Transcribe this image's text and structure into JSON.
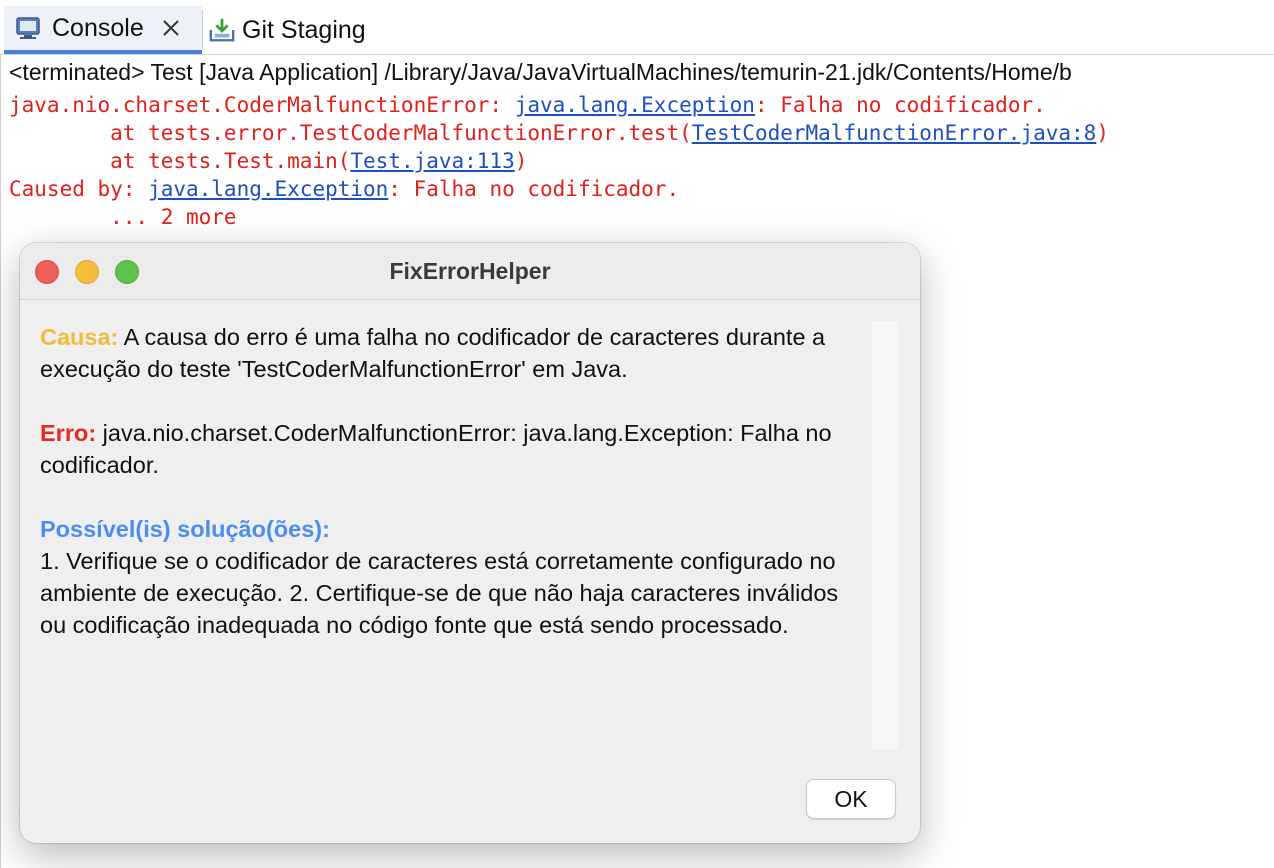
{
  "tabs": [
    {
      "label": "Console",
      "icon": "console-icon",
      "active": true
    },
    {
      "label": "Git Staging",
      "icon": "git-staging-icon",
      "active": false
    }
  ],
  "console": {
    "status": "<terminated> Test [Java Application] /Library/Java/JavaVirtualMachines/temurin-21.jdk/Contents/Home/b",
    "lines": {
      "l1_prefix": "java.nio.charset.CoderMalfunctionError: ",
      "l1_link": "java.lang.Exception",
      "l1_suffix": ": Falha no codificador.",
      "l2_prefix": "        at tests.error.TestCoderMalfunctionError.test(",
      "l2_link": "TestCoderMalfunctionError.java:8",
      "l2_suffix": ")",
      "l3_prefix": "        at tests.Test.main(",
      "l3_link": "Test.java:113",
      "l3_suffix": ")",
      "l4_prefix": "Caused by: ",
      "l4_link": "java.lang.Exception",
      "l4_suffix": ": Falha no codificador.",
      "l5": "        ... 2 more"
    },
    "colors": {
      "error": "#e0201c",
      "link": "#1d4fbf"
    }
  },
  "dialog": {
    "title": "FixErrorHelper",
    "causa_label": "Causa:",
    "causa_text": " A causa do erro é uma falha no codificador de caracteres durante a execução do teste 'TestCoderMalfunctionError' em Java.",
    "erro_label": "Erro:",
    "erro_text": " java.nio.charset.CoderMalfunctionError: java.lang.Exception: Falha no codificador.",
    "sol_label": "Possível(is) solução(ões):",
    "sol_text": "1. Verifique se o codificador de caracteres está corretamente configurado no ambiente de execução. 2. Certifique-se de que não haja caracteres inválidos ou codificação inadequada no código fonte que está sendo processado.",
    "ok_label": "OK",
    "colors": {
      "causa": "#f4bb3a",
      "erro": "#e32c1f",
      "solucao": "#4b8ef0"
    }
  }
}
